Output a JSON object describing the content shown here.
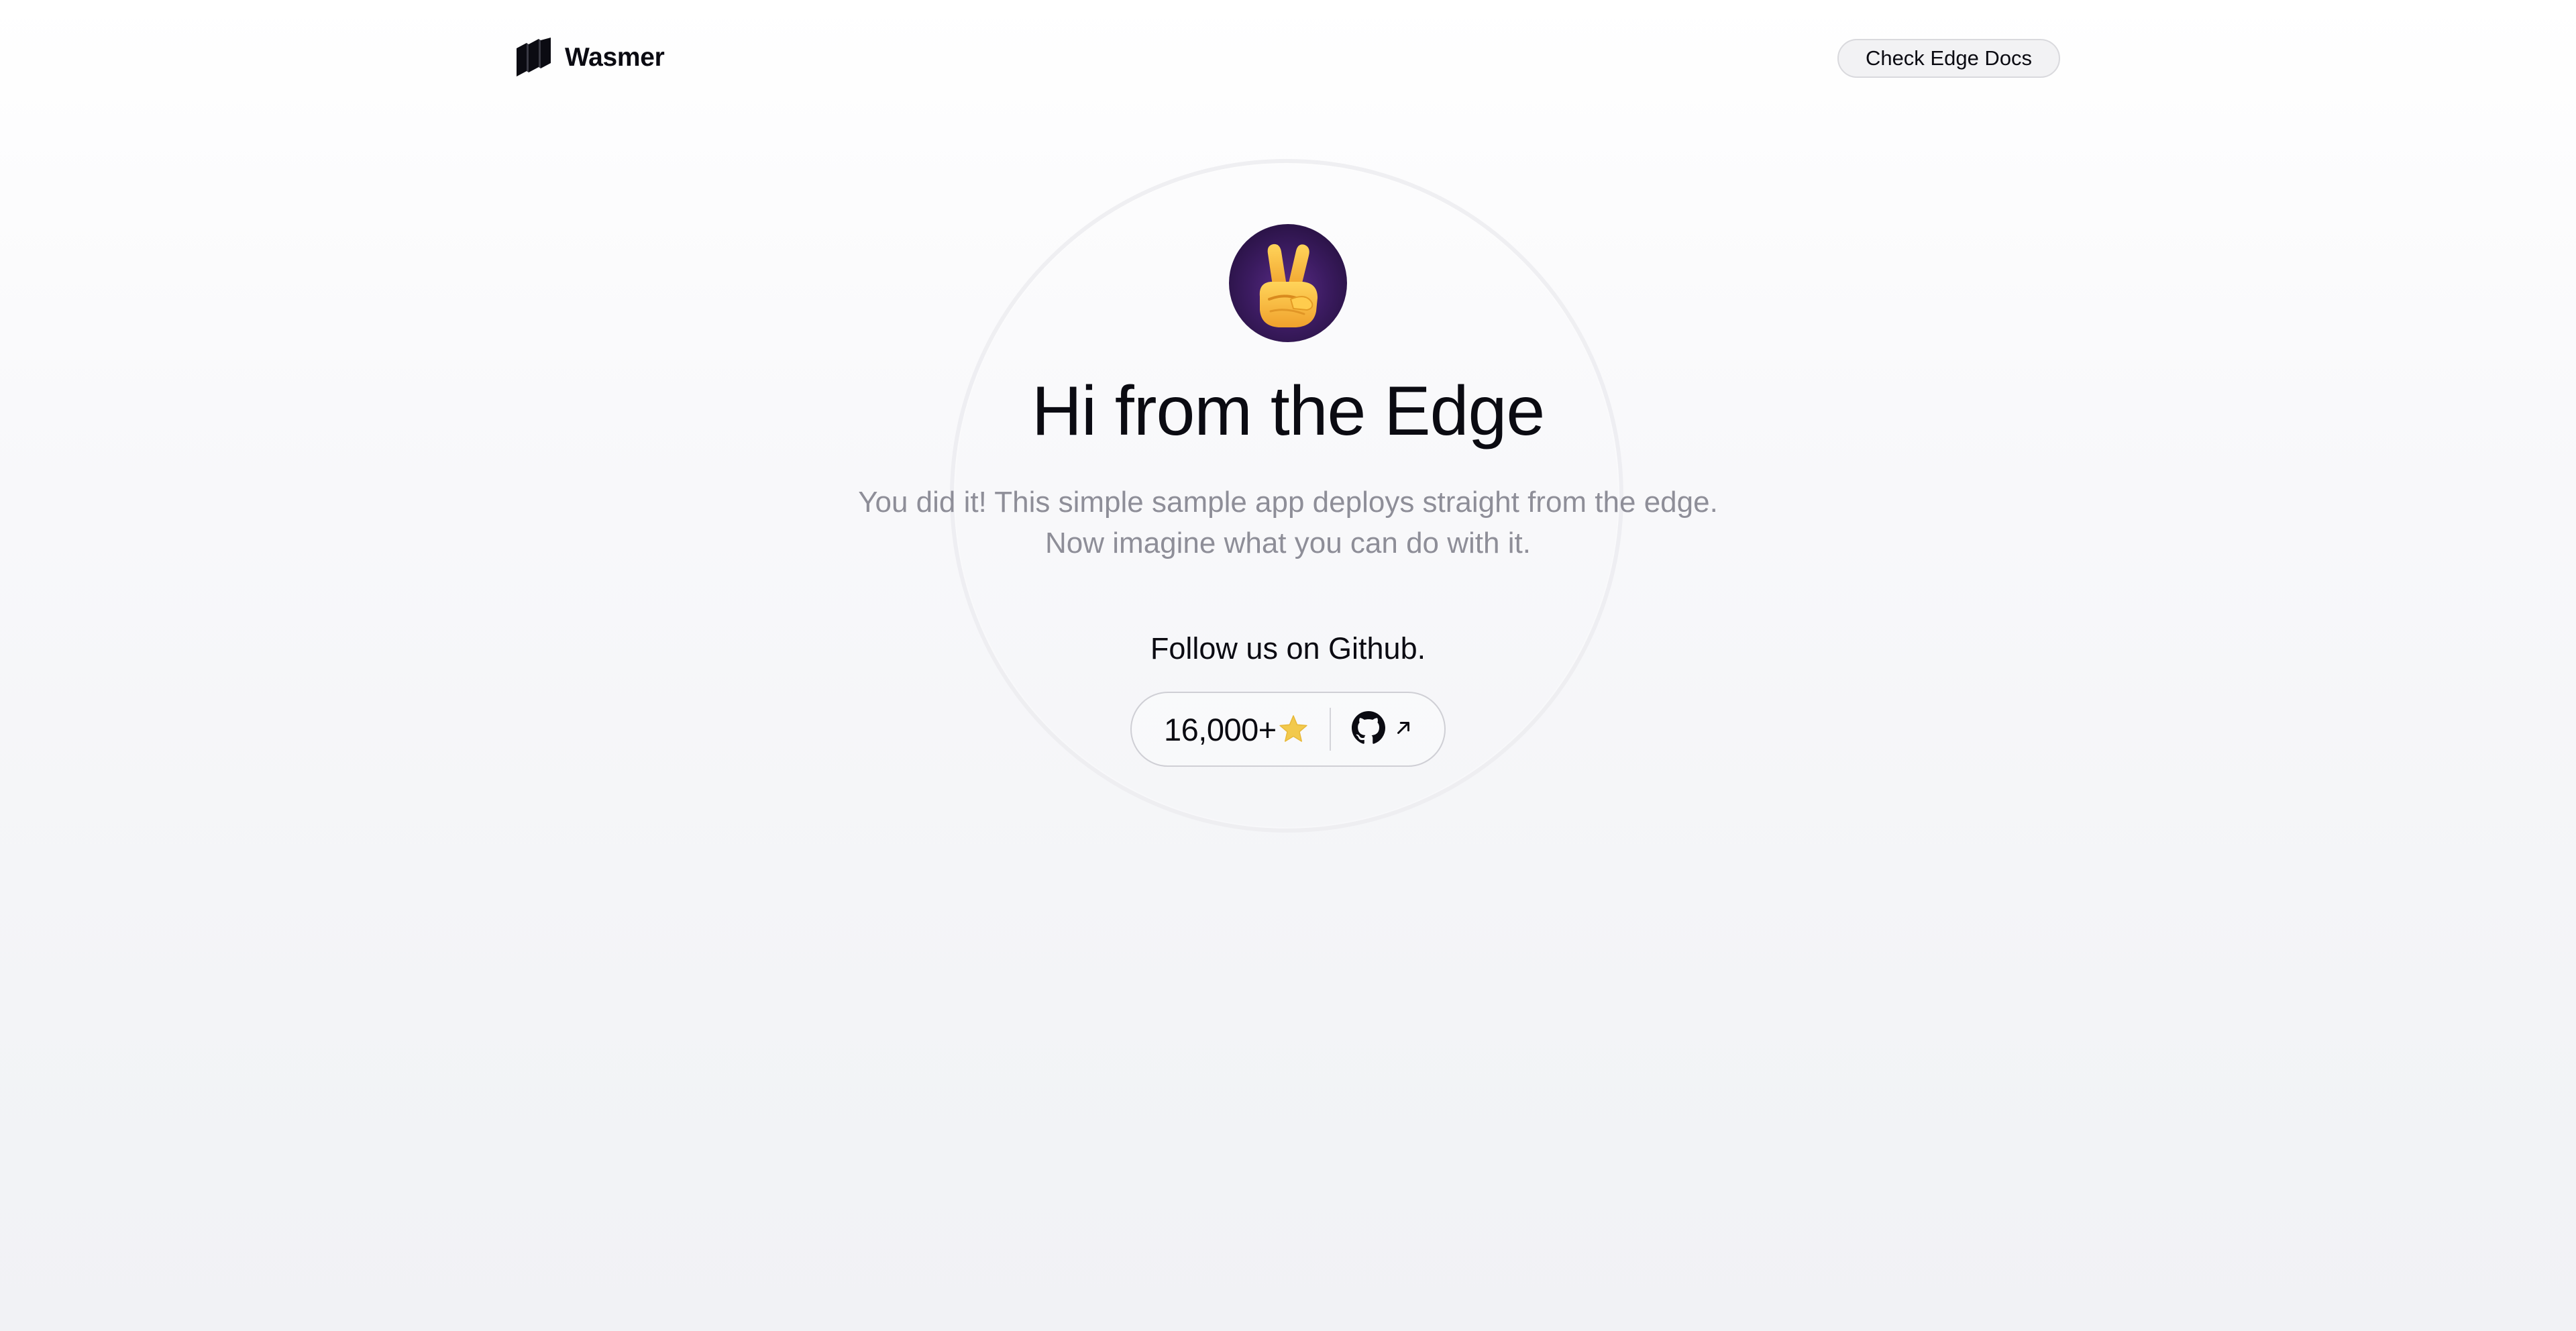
{
  "header": {
    "brand": "Wasmer",
    "docs_button": "Check Edge Docs"
  },
  "hero": {
    "avatar_icon": "victory-hand-emoji-icon",
    "title": "Hi from the Edge",
    "subtitle_line1": "You did it! This simple sample app deploys straight from the edge.",
    "subtitle_line2": "Now imagine what you can do with it.",
    "follow_text": "Follow us on Github."
  },
  "github": {
    "stars": "16,000+",
    "star_icon": "star-icon",
    "link_icon": "github-icon",
    "external_icon": "arrow-up-right-icon"
  },
  "colors": {
    "text": "#0b0b12",
    "muted": "#8e8e98",
    "star": "#f2c94c",
    "avatar_bg": "#3b1b60"
  }
}
